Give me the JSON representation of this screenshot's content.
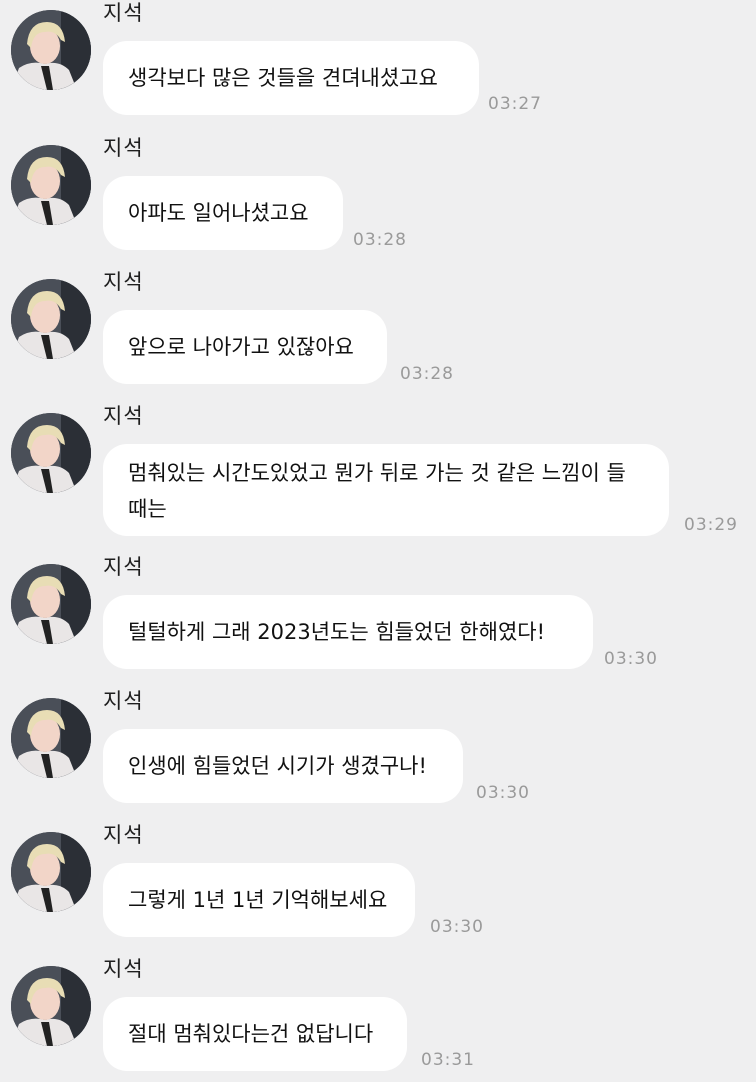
{
  "messages": [
    {
      "sender": "지석",
      "text": "생각보다 많은 것들을 견뎌내셨고요",
      "time": "03:27"
    },
    {
      "sender": "지석",
      "text": "아파도 일어나셨고요",
      "time": "03:28"
    },
    {
      "sender": "지석",
      "text": "앞으로 나아가고 있잖아요",
      "time": "03:28"
    },
    {
      "sender": "지석",
      "text": "멈춰있는 시간도있었고 뭔가 뒤로 가는 것 같은 느낌이 들 때는",
      "time": "03:29"
    },
    {
      "sender": "지석",
      "text": "털털하게 그래 2023년도는 힘들었던 한해였다!",
      "time": "03:30"
    },
    {
      "sender": "지석",
      "text": "인생에 힘들었던 시기가 생겼구나!",
      "time": "03:30"
    },
    {
      "sender": "지석",
      "text": "그렇게 1년 1년 기억해보세요",
      "time": "03:30"
    },
    {
      "sender": "지석",
      "text": "절대 멈춰있다는건 없답니다",
      "time": "03:31"
    }
  ],
  "colors": {
    "background": "#efeff0",
    "bubble": "#ffffff",
    "time": "#9a9a9a"
  }
}
